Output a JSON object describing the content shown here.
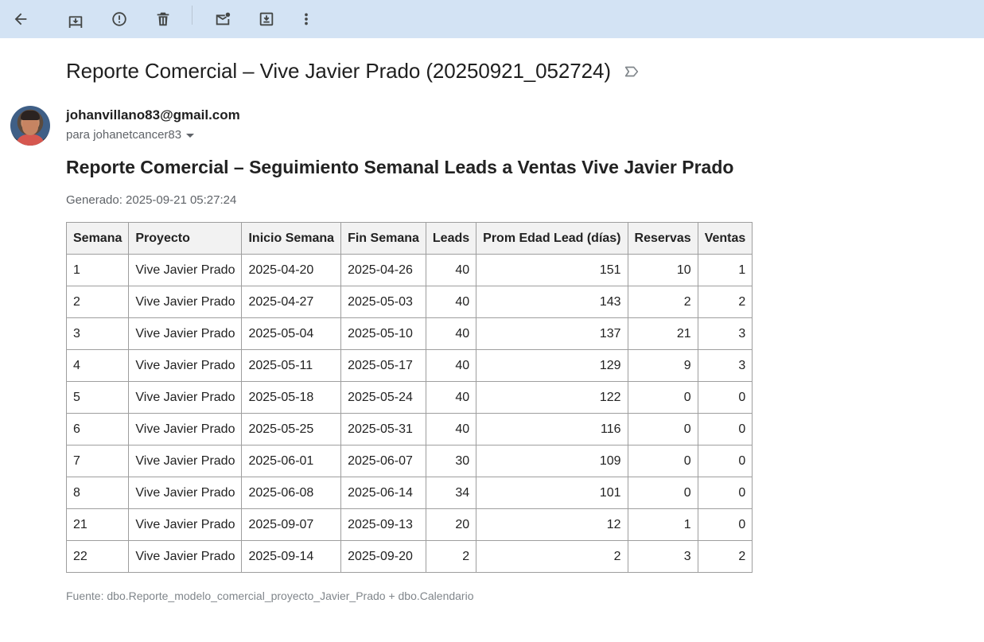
{
  "toolbar": {
    "icons": [
      "back-arrow-icon",
      "archive-icon",
      "report-spam-icon",
      "delete-icon",
      "mark-unread-icon",
      "move-to-icon",
      "more-vert-icon"
    ]
  },
  "email": {
    "subject": "Reporte Comercial – Vive Javier Prado (20250921_052724)",
    "sender": "johanvillano83@gmail.com",
    "recipient": "para johanetcancer83"
  },
  "body": {
    "title": "Reporte Comercial – Seguimiento Semanal Leads a Ventas Vive Javier Prado",
    "generated": "Generado: 2025-09-21 05:27:24",
    "table": {
      "headers": [
        "Semana",
        "Proyecto",
        "Inicio Semana",
        "Fin Semana",
        "Leads",
        "Prom Edad Lead (días)",
        "Reservas",
        "Ventas"
      ],
      "rows": [
        [
          "1",
          "Vive Javier Prado",
          "2025-04-20",
          "2025-04-26",
          "40",
          "151",
          "10",
          "1"
        ],
        [
          "2",
          "Vive Javier Prado",
          "2025-04-27",
          "2025-05-03",
          "40",
          "143",
          "2",
          "2"
        ],
        [
          "3",
          "Vive Javier Prado",
          "2025-05-04",
          "2025-05-10",
          "40",
          "137",
          "21",
          "3"
        ],
        [
          "4",
          "Vive Javier Prado",
          "2025-05-11",
          "2025-05-17",
          "40",
          "129",
          "9",
          "3"
        ],
        [
          "5",
          "Vive Javier Prado",
          "2025-05-18",
          "2025-05-24",
          "40",
          "122",
          "0",
          "0"
        ],
        [
          "6",
          "Vive Javier Prado",
          "2025-05-25",
          "2025-05-31",
          "40",
          "116",
          "0",
          "0"
        ],
        [
          "7",
          "Vive Javier Prado",
          "2025-06-01",
          "2025-06-07",
          "30",
          "109",
          "0",
          "0"
        ],
        [
          "8",
          "Vive Javier Prado",
          "2025-06-08",
          "2025-06-14",
          "34",
          "101",
          "0",
          "0"
        ],
        [
          "21",
          "Vive Javier Prado",
          "2025-09-07",
          "2025-09-13",
          "20",
          "12",
          "1",
          "0"
        ],
        [
          "22",
          "Vive Javier Prado",
          "2025-09-14",
          "2025-09-20",
          "2",
          "2",
          "3",
          "2"
        ]
      ]
    },
    "source": "Fuente: dbo.Reporte_modelo_comercial_proyecto_Javier_Prado + dbo.Calendario"
  },
  "colors": {
    "toolbar_bg": "#d3e3f4",
    "table_header_bg": "#f2f2f2",
    "border": "#9e9e9e"
  }
}
